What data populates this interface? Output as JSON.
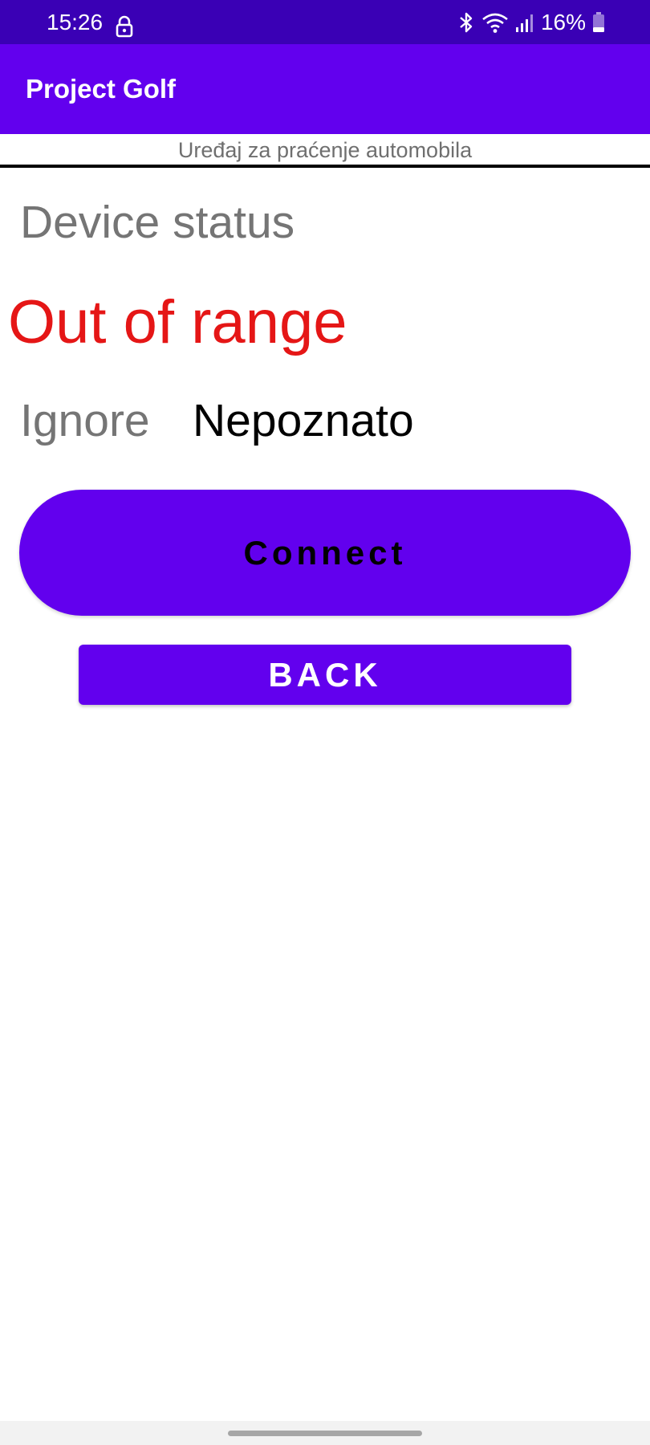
{
  "status_bar": {
    "time": "15:26",
    "battery": "16%",
    "icons": [
      "lock-icon",
      "bluetooth-icon",
      "wifi-icon",
      "signal-icon",
      "battery-icon"
    ]
  },
  "app_bar": {
    "title": "Project Golf"
  },
  "subtitle": "Uređaj za praćenje automobila",
  "device_status": {
    "label": "Device status",
    "value": "Out of range"
  },
  "ignore": {
    "label": "Ignore",
    "value": "Nepoznato"
  },
  "buttons": {
    "connect": "Connect",
    "back": "BACK"
  },
  "colors": {
    "status_bar": "#3a00b5",
    "primary": "#6200ee",
    "status_value": "#e51616",
    "label_gray": "#757575"
  }
}
